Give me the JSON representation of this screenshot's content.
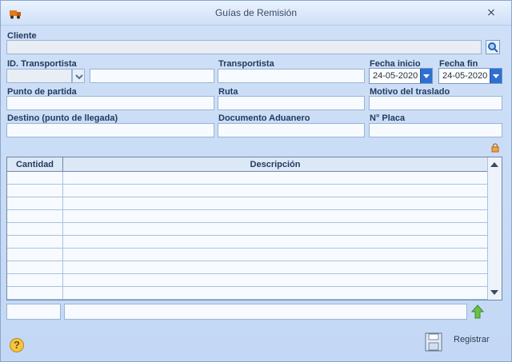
{
  "window": {
    "title": "Guías de Remisión"
  },
  "labels": {
    "cliente": "Cliente",
    "id_transportista": "ID. Transportista",
    "transportista": "Transportista",
    "fecha_inicio": "Fecha inicio",
    "fecha_fin": "Fecha fin",
    "punto_partida": "Punto de partida",
    "ruta": "Ruta",
    "motivo_traslado": "Motivo del traslado",
    "destino": "Destino (punto de llegada)",
    "documento_aduanero": "Documento Aduanero",
    "placa": "N° Placa"
  },
  "values": {
    "fecha_inicio": "24-05-2020",
    "fecha_fin": "24-05-2020"
  },
  "grid": {
    "headers": [
      "Cantidad",
      "Descripción"
    ],
    "rows": [
      "",
      "",
      "",
      "",
      "",
      "",
      "",
      "",
      "",
      ""
    ]
  },
  "actions": {
    "registrar": "Registrar",
    "help": "?"
  }
}
